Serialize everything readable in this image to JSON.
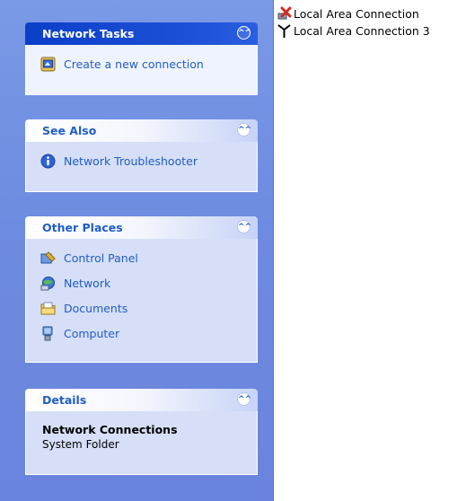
{
  "network_tasks": {
    "title": "Network Tasks",
    "items": [
      {
        "label": "Create a new connection",
        "icon": "new-connection-icon"
      }
    ]
  },
  "see_also": {
    "title": "See Also",
    "items": [
      {
        "label": "Network Troubleshooter",
        "icon": "info-icon"
      }
    ]
  },
  "other_places": {
    "title": "Other Places",
    "items": [
      {
        "label": "Control Panel",
        "icon": "control-panel-icon"
      },
      {
        "label": "Network",
        "icon": "network-icon"
      },
      {
        "label": "Documents",
        "icon": "documents-folder-icon"
      },
      {
        "label": "Computer",
        "icon": "computer-icon"
      }
    ]
  },
  "details": {
    "title": "Details",
    "name": "Network Connections",
    "type": "System Folder"
  },
  "connections": [
    {
      "label": "Local Area Connection",
      "icon": "disconnected-network-icon"
    },
    {
      "label": "Local Area Connection 3",
      "icon": "network-antenna-icon"
    }
  ],
  "colors": {
    "pane_background": "#6d8be0",
    "special_header": "#0a3fc8",
    "link_blue": "#215dc6",
    "panel_body": "#d6dff7"
  }
}
